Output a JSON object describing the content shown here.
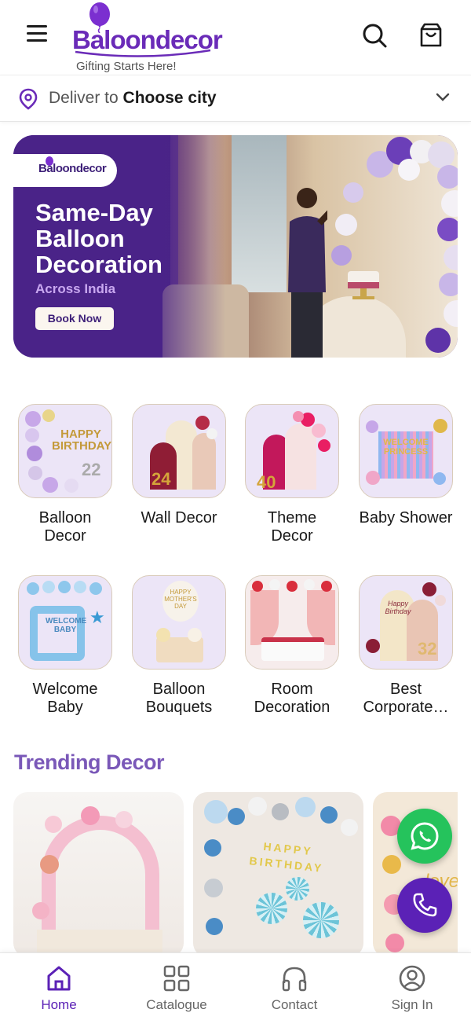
{
  "header": {
    "brand": "Baloondecor",
    "tagline": "Gifting Starts Here!",
    "brand_color": "#6a2bb8",
    "icons": [
      "menu-icon",
      "search-icon",
      "shopping-bag-icon"
    ]
  },
  "location": {
    "prefix": "Deliver to",
    "city": "Choose city",
    "icon": "location-pin-icon"
  },
  "banner": {
    "logo": "Baloondecor",
    "title": "Same-Day Balloon Decoration",
    "subtitle": "Across India",
    "button": "Book Now"
  },
  "categories": [
    {
      "label": "Balloon Decor"
    },
    {
      "label": "Wall Decor"
    },
    {
      "label": "Theme Decor"
    },
    {
      "label": "Baby Shower"
    },
    {
      "label": "Welcome Baby"
    },
    {
      "label": "Balloon Bouquets"
    },
    {
      "label": "Room Decoration"
    },
    {
      "label": "Best Corporate…"
    }
  ],
  "category_text": {
    "c0a": "Balloon",
    "c0b": "Decor",
    "c1a": "Wall Decor",
    "c2a": "Theme",
    "c2b": "Decor",
    "c3a": "Baby Shower",
    "c4a": "Welcome",
    "c4b": "Baby",
    "c5a": "Balloon",
    "c5b": "Bouquets",
    "c6a": "Room",
    "c6b": "Decoration",
    "c7a": "Best",
    "c7b": "Corporate…"
  },
  "image_text": {
    "happy_birthday": "HAPPY BIRTHDAY",
    "age_22": "22",
    "age_24": "24",
    "age_40": "40",
    "welcome_princess": "WELCOME PRINCESS",
    "welcome_baby": "WELCOME BABY",
    "happy_mothers_day": "HAPPY MOTHER'S DAY",
    "happy_birthday_script": "Happy Birthday",
    "age_32": "32",
    "happy_birthday_banner": "HAPPY BIRTHDAY",
    "love": "love"
  },
  "trending": {
    "title": "Trending Decor"
  },
  "fabs": {
    "whatsapp_color": "#25c35c",
    "call_color": "#5b21b6"
  },
  "nav": {
    "home": "Home",
    "catalogue": "Catalogue",
    "contact": "Contact",
    "signin": "Sign In",
    "active_color": "#5b21b6"
  }
}
